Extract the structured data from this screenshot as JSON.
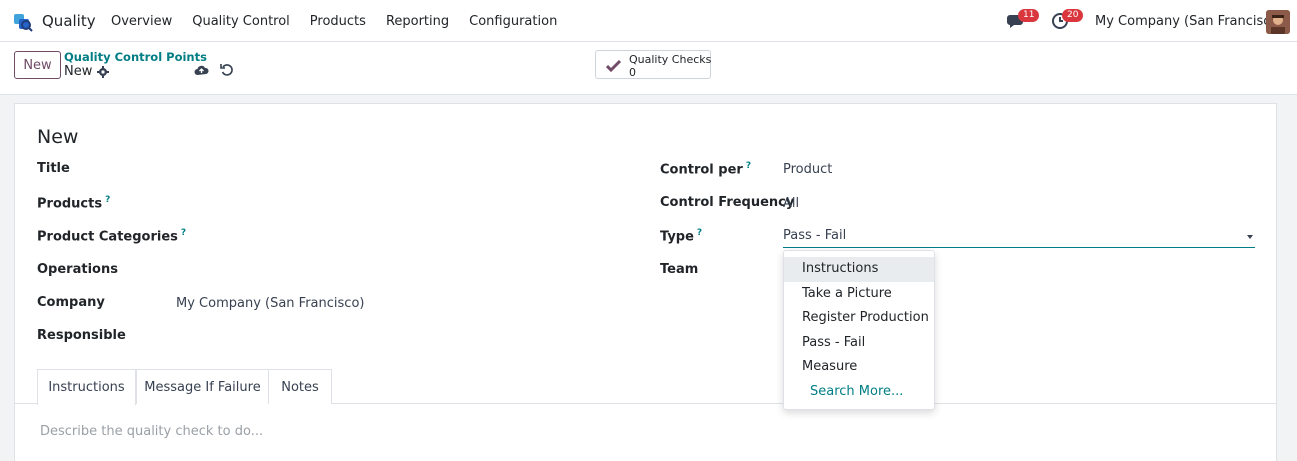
{
  "navbar": {
    "app_name": "Quality",
    "menu": [
      "Overview",
      "Quality Control",
      "Products",
      "Reporting",
      "Configuration"
    ],
    "messages_count": "11",
    "activities_count": "20",
    "company": "My Company (San Francisco)"
  },
  "control": {
    "new_label": "New",
    "breadcrumb": "Quality Control Points",
    "record_name": "New",
    "stat_label": "Quality Checks",
    "stat_value": "0"
  },
  "form": {
    "title": "New",
    "left": {
      "title_label": "Title",
      "products_label": "Products",
      "product_categories_label": "Product Categories",
      "operations_label": "Operations",
      "company_label": "Company",
      "company_value": "My Company (San Francisco)",
      "responsible_label": "Responsible"
    },
    "right": {
      "control_per_label": "Control per",
      "control_per_value": "Product",
      "control_frequency_label": "Control Frequency",
      "control_frequency_value": "All",
      "type_label": "Type",
      "type_value": "Pass - Fail",
      "team_label": "Team"
    },
    "help_mark": "?"
  },
  "tabs": [
    "Instructions",
    "Message If Failure",
    "Notes"
  ],
  "instructions_placeholder": "Describe the quality check to do...",
  "dropdown": {
    "options": [
      "Instructions",
      "Take a Picture",
      "Register Production",
      "Pass - Fail",
      "Measure"
    ],
    "search_more": "Search More..."
  },
  "colors": {
    "brand": "#714b67",
    "accent": "#017e84",
    "badge": "#d9363e"
  },
  "icons": [
    "quality-app-icon",
    "chat-icon",
    "clock-icon",
    "gear-icon",
    "cloud-save-icon",
    "undo-icon",
    "checkmark-icon"
  ]
}
